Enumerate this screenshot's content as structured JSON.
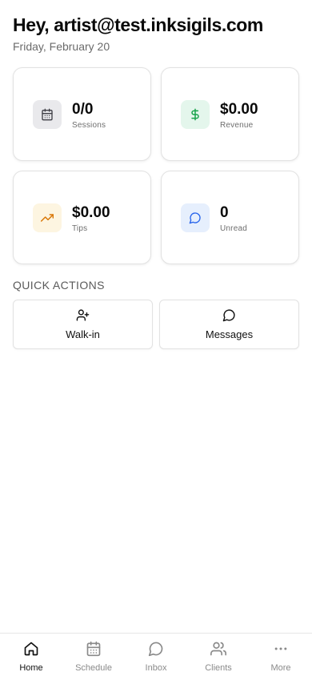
{
  "header": {
    "greeting": "Hey, artist@test.inksigils.com",
    "date": "Friday, February 20"
  },
  "stats": [
    {
      "value": "0/0",
      "label": "Sessions",
      "icon": "calendar-icon",
      "icon_bg": "#e9e9ec",
      "icon_color": "#3f3f46"
    },
    {
      "value": "$0.00",
      "label": "Revenue",
      "icon": "dollar-icon",
      "icon_bg": "#e4f6ec",
      "icon_color": "#16a34a"
    },
    {
      "value": "$0.00",
      "label": "Tips",
      "icon": "trending-up-icon",
      "icon_bg": "#fdf5e1",
      "icon_color": "#d97706"
    },
    {
      "value": "0",
      "label": "Unread",
      "icon": "message-circle-icon",
      "icon_bg": "#e6effd",
      "icon_color": "#2563eb"
    }
  ],
  "quick_actions": {
    "title": "QUICK ACTIONS",
    "items": [
      {
        "label": "Walk-in",
        "icon": "user-plus-icon"
      },
      {
        "label": "Messages",
        "icon": "message-circle-icon"
      }
    ]
  },
  "tabbar": {
    "items": [
      {
        "label": "Home",
        "icon": "home-icon",
        "active": true
      },
      {
        "label": "Schedule",
        "icon": "calendar-icon",
        "active": false
      },
      {
        "label": "Inbox",
        "icon": "message-circle-icon",
        "active": false
      },
      {
        "label": "Clients",
        "icon": "users-icon",
        "active": false
      },
      {
        "label": "More",
        "icon": "more-horizontal-icon",
        "active": false
      }
    ]
  }
}
